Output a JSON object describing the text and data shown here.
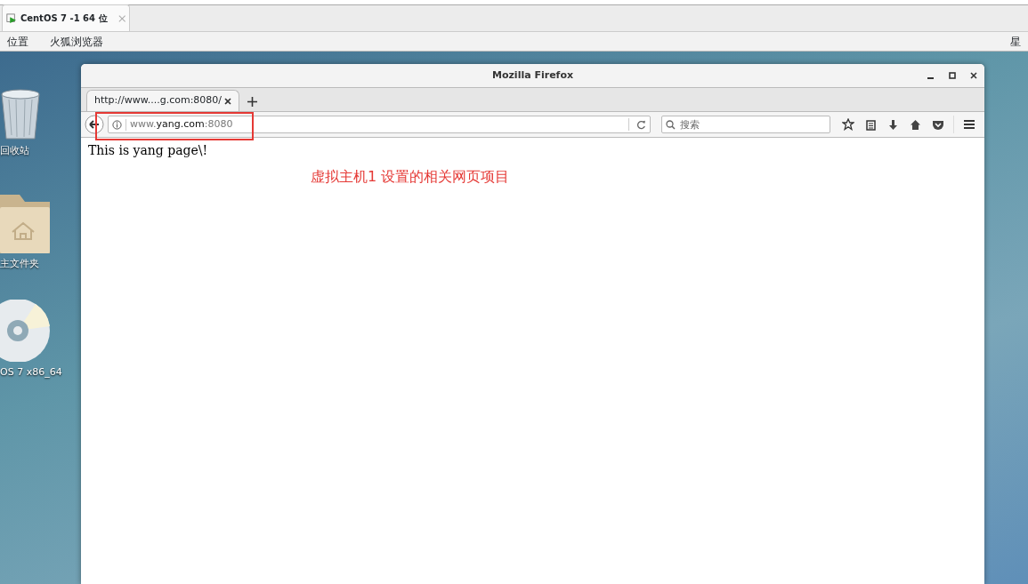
{
  "vm_tab": {
    "title": "CentOS 7 -1 64 位"
  },
  "menu_bar": {
    "items": [
      "位置",
      "火狐浏览器"
    ],
    "right_text": "星"
  },
  "desktop_icons": [
    {
      "kind": "trash",
      "label": "回收站"
    },
    {
      "kind": "folder",
      "label": "主文件夹"
    },
    {
      "kind": "disc",
      "label": "OS 7 x86_64"
    }
  ],
  "window": {
    "title": "Mozilla Firefox"
  },
  "tabs": [
    {
      "label": "http://www....g.com:8080/",
      "selected": true
    }
  ],
  "url_bar": {
    "host_prefix": "www.",
    "host": "yang.com",
    "port": ":8080"
  },
  "search": {
    "placeholder": "搜索"
  },
  "page": {
    "text": "This is yang page\\!"
  },
  "annotation": {
    "text": "虚拟主机1 设置的相关网页项目"
  }
}
